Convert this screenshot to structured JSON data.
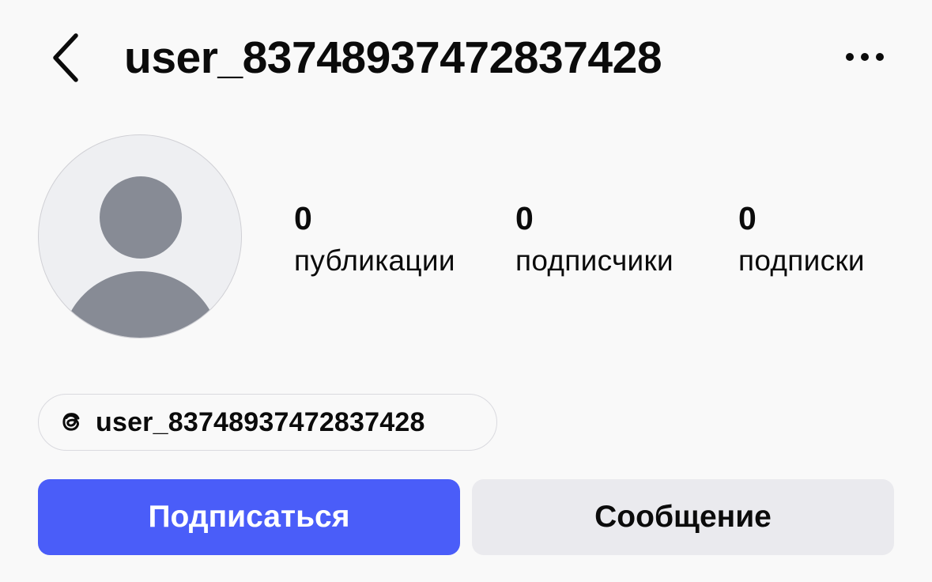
{
  "header": {
    "username": "user_83748937472837428",
    "back_icon": "chevron-left-icon",
    "more_icon": "more-horizontal-icon"
  },
  "avatar": {
    "icon": "default-user-avatar-icon"
  },
  "stats": {
    "posts": {
      "count": "0",
      "label": "публикации"
    },
    "followers": {
      "count": "0",
      "label": "подписчики"
    },
    "following": {
      "count": "0",
      "label": "подписки"
    }
  },
  "threads": {
    "icon": "threads-icon",
    "username": "user_83748937472837428"
  },
  "actions": {
    "follow_label": "Подписаться",
    "message_label": "Сообщение"
  },
  "colors": {
    "accent": "#4a5df9",
    "secondary_button": "#eaeaee",
    "background": "#f9f9f9",
    "text": "#0b0b0b",
    "avatar_bg": "#eeeff2",
    "avatar_figure": "#878b95"
  }
}
